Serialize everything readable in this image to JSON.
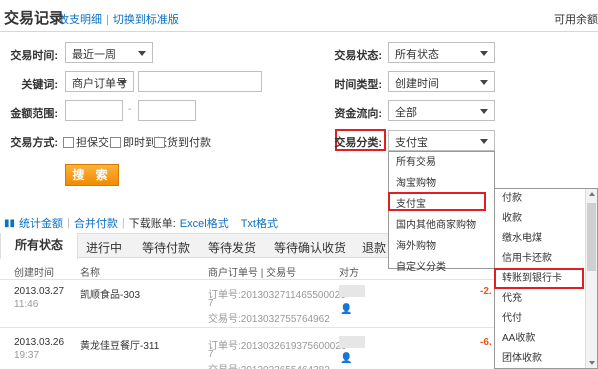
{
  "header": {
    "title": "交易记录",
    "link_income": "收支明细",
    "sep": "|",
    "link_switch": "切换到标准版",
    "right_text": "可用余额"
  },
  "filters": {
    "time_label": "交易时间:",
    "time_value": "最近一周",
    "keyword_label": "关键词:",
    "keyword_type": "商户订单号",
    "keyword_value": "",
    "amount_label": "金额范围:",
    "amount_dash": "-",
    "method_label": "交易方式:",
    "methods": [
      "担保交易",
      "即时到帐",
      "货到付款"
    ],
    "status_label": "交易状态:",
    "status_value": "所有状态",
    "time_type_label": "时间类型:",
    "time_type_value": "创建时间",
    "flow_label": "资金流向:",
    "flow_value": "全部",
    "category_label": "交易分类:",
    "category_value": "支付宝",
    "search_button": "搜 索"
  },
  "category_dropdown": [
    "所有交易",
    "淘宝购物",
    "支付宝",
    "国内其他商家购物",
    "海外购物",
    "自定义分类"
  ],
  "subcategory_dropdown": [
    "付款",
    "收款",
    "缴水电煤",
    "信用卡还款",
    "转账到银行卡",
    "代充",
    "代付",
    "AA收款",
    "团体收款"
  ],
  "tools": {
    "stats": "统计金额",
    "merge": "合并付款",
    "download_label": "下载账单:",
    "excel": "Excel格式",
    "txt": "Txt格式"
  },
  "tabs": [
    "所有状态",
    "进行中",
    "等待付款",
    "等待发货",
    "等待确认收货",
    "退款"
  ],
  "table": {
    "columns": [
      "创建时间",
      "名称",
      "商户订单号 | 交易号",
      "对方"
    ],
    "rows": [
      {
        "date": "2013.03.27",
        "time": "11:46",
        "name": "凯顺食品-303",
        "order_no": "订单号:2013032711465500026",
        "order_no_tail": "7",
        "trade_no": "交易号:2013032755764962",
        "amount": "-2."
      },
      {
        "date": "2013.03.26",
        "time": "19:37",
        "name": "黄龙佳豆餐厅-311",
        "order_no": "订单号:2013032619375600026",
        "order_no_tail": "7",
        "trade_no": "交易号:2013032655464383",
        "amount": "-6."
      }
    ]
  },
  "colors": {
    "link": "#0c6fc1",
    "accent_orange": "#f08a00",
    "highlight_red": "#e02020",
    "amount_red": "#e8561b"
  }
}
